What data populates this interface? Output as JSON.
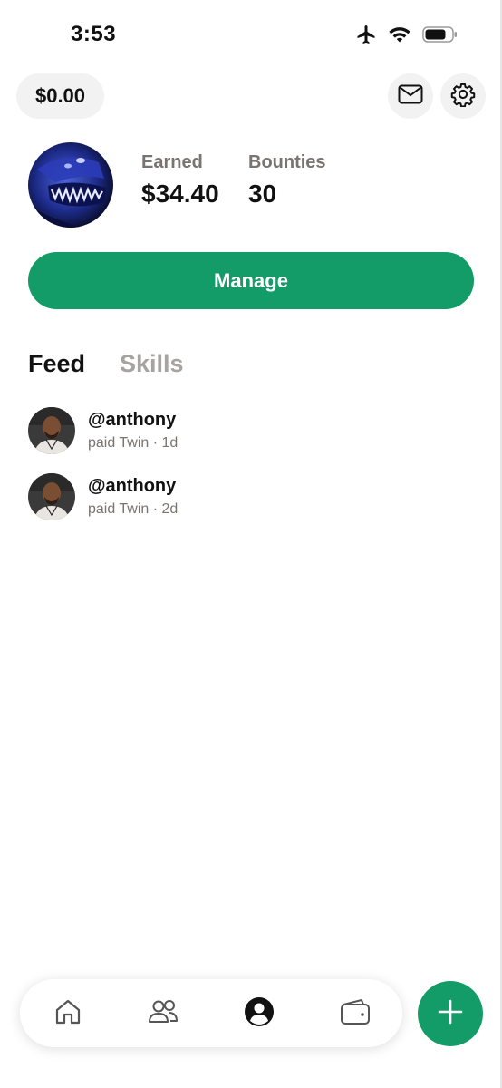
{
  "status_bar": {
    "time": "3:53",
    "icons": [
      "airplane-icon",
      "wifi-icon",
      "battery-icon"
    ]
  },
  "header": {
    "balance": "$0.00",
    "mail_icon": "mail-icon",
    "settings_icon": "gear-icon"
  },
  "profile": {
    "earned_label": "Earned",
    "earned_value": "$34.40",
    "bounties_label": "Bounties",
    "bounties_value": "30"
  },
  "manage_button": {
    "label": "Manage"
  },
  "tabs": [
    {
      "label": "Feed",
      "active": true
    },
    {
      "label": "Skills",
      "active": false
    }
  ],
  "feed": [
    {
      "username": "@anthony",
      "subtitle": "paid Twin · 1d"
    },
    {
      "username": "@anthony",
      "subtitle": "paid Twin · 2d"
    }
  ],
  "bottom_nav": {
    "items": [
      {
        "icon": "home-icon",
        "active": false
      },
      {
        "icon": "people-icon",
        "active": false
      },
      {
        "icon": "profile-icon",
        "active": true
      },
      {
        "icon": "wallet-icon",
        "active": false
      }
    ],
    "fab_icon": "plus-icon"
  },
  "colors": {
    "accent": "#139c68",
    "pill_bg": "#f2f2f2",
    "muted_text": "#7a7471",
    "inactive_tab": "#a7a3a1"
  }
}
